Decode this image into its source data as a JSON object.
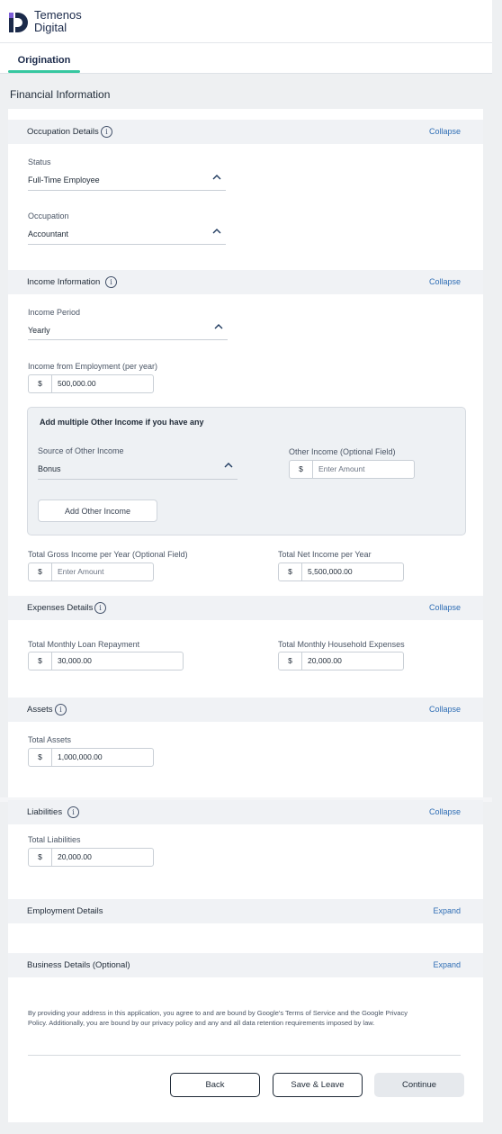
{
  "header": {
    "brand_line1": "Temenos",
    "brand_line2": "Digital",
    "tab": "Origination"
  },
  "page_title": "Financial Information",
  "colors": {
    "accent": "#36c7a0",
    "link": "#2f6eb5",
    "section_header": "#f0f2f5"
  },
  "occupation": {
    "title": "Occupation Details",
    "link": "Collapse",
    "status_label": "Status",
    "status_value": "Full-Time Employee",
    "occupation_label": "Occupation",
    "occupation_value": "Accountant"
  },
  "income": {
    "title": "Income Information",
    "link": "Collapse",
    "period_label": "Income Period",
    "period_value": "Yearly",
    "employment_label": "Income from Employment (per year)",
    "employment_currency": "$",
    "employment_value": "500,000.00",
    "other_heading": "Add multiple Other Income if you have any",
    "source_label": "Source of Other Income",
    "source_value": "Bonus",
    "other_label": "Other Income (Optional Field)",
    "other_currency": "$",
    "other_placeholder": "Enter Amount",
    "add_button": "Add Other Income",
    "gross_label": "Total Gross Income per Year (Optional Field)",
    "gross_currency": "$",
    "gross_placeholder": "Enter Amount",
    "net_label": "Total Net Income per Year",
    "net_currency": "$",
    "net_value": "5,500,000.00"
  },
  "expenses": {
    "title": "Expenses Details",
    "link": "Collapse",
    "loan_label": "Total Monthly Loan Repayment",
    "loan_currency": "$",
    "loan_value": "30,000.00",
    "household_label": "Total Monthly Household Expenses",
    "household_currency": "$",
    "household_value": "20,000.00"
  },
  "assets": {
    "title": "Assets",
    "link": "Collapse",
    "label": "Total Assets",
    "currency": "$",
    "value": "1,000,000.00"
  },
  "liabilities": {
    "title": "Liabilities",
    "link": "Collapse",
    "label": "Total Liabilities",
    "currency": "$",
    "value": "20,000.00"
  },
  "employment": {
    "title": "Employment Details",
    "link": "Expand"
  },
  "business": {
    "title": "Business Details (Optional)",
    "link": "Expand"
  },
  "disclaimer": "By providing your address in this application, you agree to and are bound by Google's Terms of Service and the Google Privacy Policy. Additionally, you are bound by our privacy policy and any and all data retention requirements imposed by law.",
  "buttons": {
    "back": "Back",
    "save_leave": "Save & Leave",
    "continue": "Continue"
  }
}
